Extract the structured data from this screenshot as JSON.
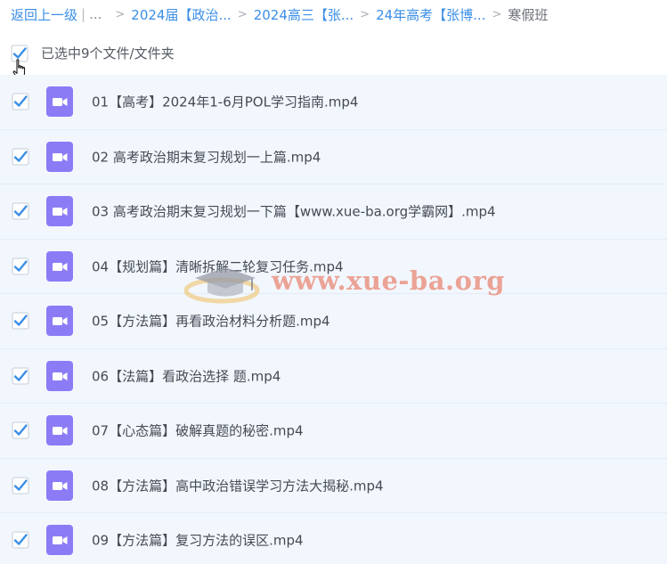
{
  "breadcrumb": {
    "back_label": "返回上一级",
    "divider": "|",
    "ellipsis": "...",
    "separator": ">",
    "items": [
      {
        "label": "2024届【政治..."
      },
      {
        "label": "2024高三【张..."
      },
      {
        "label": "24年高考【张博..."
      }
    ],
    "current": "寒假班"
  },
  "selection": {
    "label": "已选中9个文件/文件夹",
    "checked": true
  },
  "files": [
    {
      "name": "01【高考】2024年1-6月POL学习指南.mp4",
      "checked": true
    },
    {
      "name": "02 高考政治期末复习规划一上篇.mp4",
      "checked": true
    },
    {
      "name": "03 高考政治期末复习规划一下篇【www.xue-ba.org学霸网】.mp4",
      "checked": true
    },
    {
      "name": "04【规划篇】清晰拆解二轮复习任务.mp4",
      "checked": true
    },
    {
      "name": "05【方法篇】再看政治材料分析题.mp4",
      "checked": true
    },
    {
      "name": "06【法篇】看政治选择 题.mp4",
      "checked": true
    },
    {
      "name": "07【心态篇】破解真题的秘密.mp4",
      "checked": true
    },
    {
      "name": "08【方法篇】高中政治错误学习方法大揭秘.mp4",
      "checked": true
    },
    {
      "name": "09【方法篇】复习方法的误区.mp4",
      "checked": true
    }
  ],
  "watermark": {
    "text": "www.xue-ba.org"
  },
  "icons": {
    "checkbox": "checkbox-checked-icon",
    "file": "video-file-icon",
    "cursor": "hand-pointer-icon",
    "watermark_logo": "graduation-cap-icon"
  },
  "colors": {
    "link": "#3a8ee6",
    "checkbox": "#3a8ee6",
    "video_icon": "#8b7cf6",
    "row_bg": "#f2f7fe",
    "row_border": "#e3ecf8",
    "text": "#454a53"
  }
}
